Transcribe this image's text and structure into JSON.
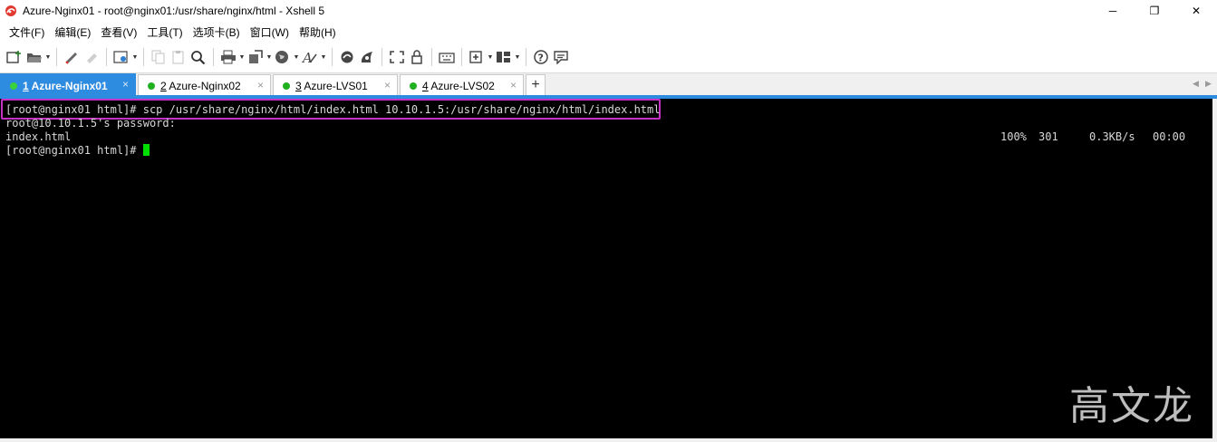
{
  "window": {
    "title": "Azure-Nginx01 - root@nginx01:/usr/share/nginx/html - Xshell 5",
    "minimize": "─",
    "restore": "❐",
    "close": "✕"
  },
  "menu": {
    "items": [
      "文件(F)",
      "编辑(E)",
      "查看(V)",
      "工具(T)",
      "选项卡(B)",
      "窗口(W)",
      "帮助(H)"
    ]
  },
  "toolbar": {
    "icons": [
      "new-session-icon",
      "open-folder-icon",
      "pencil-icon",
      "eraser-icon",
      "properties-icon",
      "copy-icon",
      "paste-icon",
      "find-icon",
      "print-icon",
      "transfer-icon",
      "globe-icon",
      "font-icon",
      "xftp-icon",
      "xmanager-icon",
      "fullscreen-icon",
      "lock-icon",
      "keyboard-icon",
      "compose-icon",
      "layout-icon",
      "help-icon",
      "chat-icon"
    ]
  },
  "tabs": [
    {
      "num": "1",
      "label": " Azure-Nginx01",
      "active": true
    },
    {
      "num": "2",
      "label": " Azure-Nginx02",
      "active": false
    },
    {
      "num": "3",
      "label": " Azure-LVS01",
      "active": false
    },
    {
      "num": "4",
      "label": " Azure-LVS02",
      "active": false
    }
  ],
  "tab_close": "×",
  "tab_add": "+",
  "tab_scroll_left": "◀",
  "tab_scroll_right": "▶",
  "terminal": {
    "lines": [
      "[root@nginx01 html]# scp /usr/share/nginx/html/index.html 10.10.1.5:/usr/share/nginx/html/index.html",
      "root@10.10.1.5's password:",
      "index.html",
      "[root@nginx01 html]# "
    ],
    "transfer": {
      "percent": "100%",
      "bytes": "301",
      "rate": "0.3KB/s",
      "time": "00:00"
    },
    "watermark": "高文龙"
  },
  "colors": {
    "accent": "#2d8be0",
    "highlight": "#c530c5",
    "cursor": "#00e000",
    "terminal_bg": "#000000",
    "terminal_fg": "#d8d8d8",
    "status_dot": "#20b020"
  }
}
